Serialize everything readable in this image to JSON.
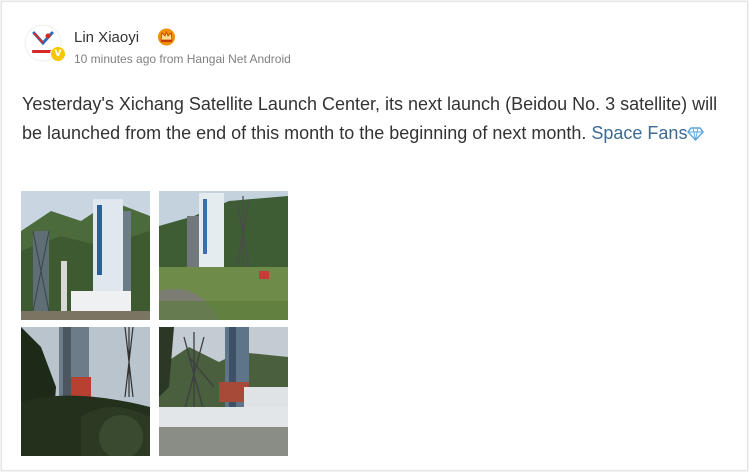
{
  "post": {
    "author_name": "Lin Xiaoyi",
    "timestamp": "10 minutes ago",
    "from_word": "from",
    "source": "Hangai Net Android",
    "text": "Yesterday's Xichang Satellite Launch Center, its next launch (Beidou No. 3 satellite) will be launched from the end of this month to the beginning of next month.",
    "topic_link": "Space Fans"
  },
  "icons": {
    "avatar": "avatar-logo",
    "verified": "verified-badge-icon",
    "member": "member-crown-icon",
    "topic": "diamond-icon"
  },
  "colors": {
    "link": "#3d6b94",
    "verified": "#f6c700",
    "member": "#f08f00"
  },
  "images": [
    {
      "name": "launch-tower-photo-1"
    },
    {
      "name": "launch-tower-photo-2"
    },
    {
      "name": "launch-tower-photo-3"
    },
    {
      "name": "launch-tower-photo-4"
    }
  ]
}
